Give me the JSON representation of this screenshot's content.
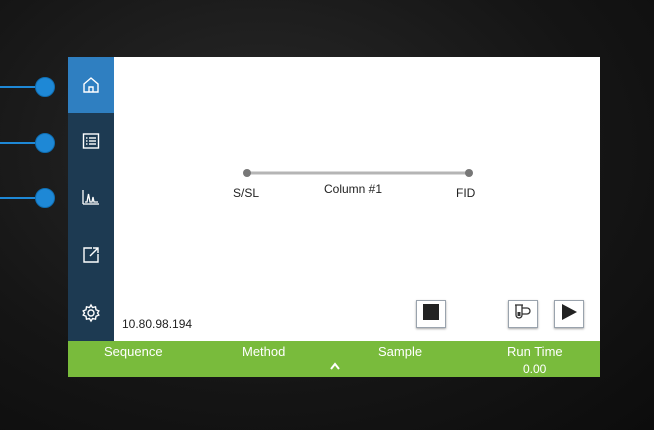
{
  "device": {
    "ip_address": "10.80.98.194"
  },
  "sidebar": {
    "items": [
      {
        "name": "home",
        "icon": "home-icon",
        "active": true
      },
      {
        "name": "list",
        "icon": "list-icon",
        "active": false
      },
      {
        "name": "chromatogram",
        "icon": "chromatogram-icon",
        "active": false
      },
      {
        "name": "export",
        "icon": "export-icon",
        "active": false
      },
      {
        "name": "settings",
        "icon": "gear-icon",
        "active": false
      }
    ]
  },
  "flow_path": {
    "inlet_label": "S/SL",
    "column_label": "Column #1",
    "detector_label": "FID"
  },
  "controls": {
    "stop_icon": "stop-icon",
    "vial_icon": "vial-icon",
    "play_icon": "play-icon"
  },
  "status_bar": {
    "sequence_label": "Sequence",
    "method_label": "Method",
    "sample_label": "Sample",
    "run_time_label": "Run Time",
    "run_time_value": "0.00",
    "expand_icon": "chevron-up-icon"
  },
  "colors": {
    "sidebar": "#1d3a52",
    "sidebar_active": "#2f7fc1",
    "status_bar": "#79bb3c",
    "callout": "#1e88d6"
  }
}
